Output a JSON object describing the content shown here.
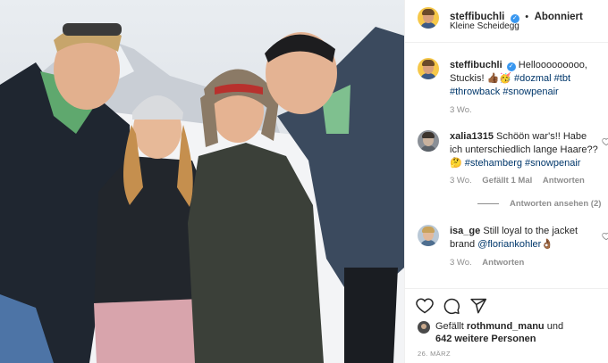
{
  "post": {
    "author": "steffibuchli",
    "follow_label": "Abonniert",
    "location": "Kleine Scheidegg",
    "dot": "•"
  },
  "caption": {
    "username": "steffibuchli",
    "text": "Hellooooooooo, Stuckis! 👍🏾🥳 ",
    "hashtags": [
      "#dozmal",
      "#tbt",
      "#throwback",
      "#snowpenair"
    ],
    "time": "3 Wo."
  },
  "comments": [
    {
      "username": "xalia1315",
      "text": "Schöön war's!! Habe ich unterschiedlich lange Haare?? 🤔",
      "hashtags": [
        "#stehamberg",
        "#snowpenair"
      ],
      "time": "3 Wo.",
      "likes": "Gefällt 1 Mal",
      "reply": "Antworten",
      "view_replies": "Antworten ansehen (2)"
    },
    {
      "username": "isa_ge",
      "text": "Still loyal to the jacket brand ",
      "mention": "@floriankohler",
      "emoji": "👌🏾",
      "time": "3 Wo.",
      "reply": "Antworten"
    }
  ],
  "likes": {
    "prefix": "Gefällt",
    "user": "rothmund_manu",
    "suffix": "und",
    "others": "642 weitere Personen"
  },
  "date": "26. MÄRZ",
  "icons": [
    "verified-badge-icon",
    "heart-icon",
    "comment-icon",
    "share-icon",
    "small-heart-icon"
  ],
  "colors": {
    "link": "#00376b",
    "verified": "#3897f0",
    "muted": "#8e8e8e"
  }
}
